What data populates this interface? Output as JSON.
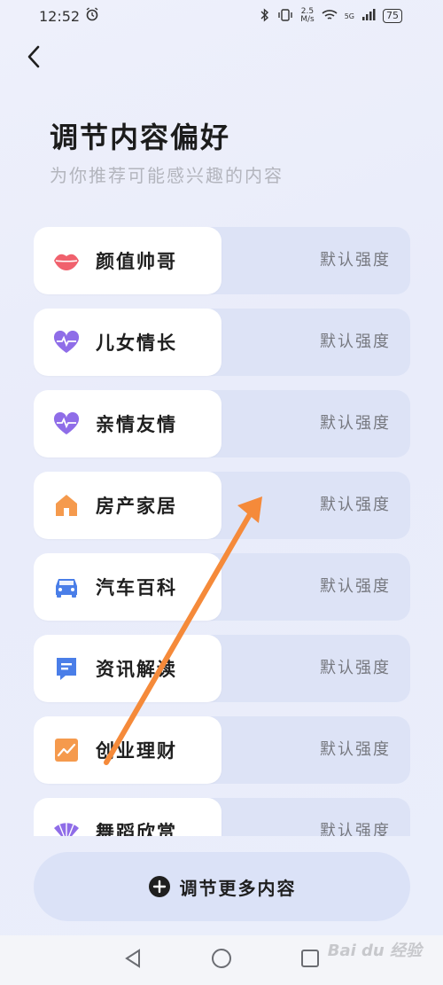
{
  "status": {
    "time": "12:52",
    "net_speed": "2.5\nM/s",
    "network": "5G",
    "battery": "75"
  },
  "header": {
    "title": "调节内容偏好",
    "subtitle": "为你推荐可能感兴趣的内容"
  },
  "items": [
    {
      "label": "颜值帅哥",
      "strength": "默认强度",
      "icon": "lips-icon",
      "color": "#f0616d"
    },
    {
      "label": "儿女情长",
      "strength": "默认强度",
      "icon": "heart-pulse-icon",
      "color": "#8f6de8"
    },
    {
      "label": "亲情友情",
      "strength": "默认强度",
      "icon": "heart-pulse-icon",
      "color": "#8f6de8"
    },
    {
      "label": "房产家居",
      "strength": "默认强度",
      "icon": "house-icon",
      "color": "#f59a4d"
    },
    {
      "label": "汽车百科",
      "strength": "默认强度",
      "icon": "car-icon",
      "color": "#4a7ee8"
    },
    {
      "label": "资讯解读",
      "strength": "默认强度",
      "icon": "news-icon",
      "color": "#4a7ee8"
    },
    {
      "label": "创业理财",
      "strength": "默认强度",
      "icon": "chart-icon",
      "color": "#f59a4d"
    },
    {
      "label": "舞蹈欣赏",
      "strength": "默认强度",
      "icon": "fan-icon",
      "color": "#8f6de8"
    }
  ],
  "more_button": {
    "label": "调节更多内容"
  },
  "watermark": "Bai du 经验"
}
